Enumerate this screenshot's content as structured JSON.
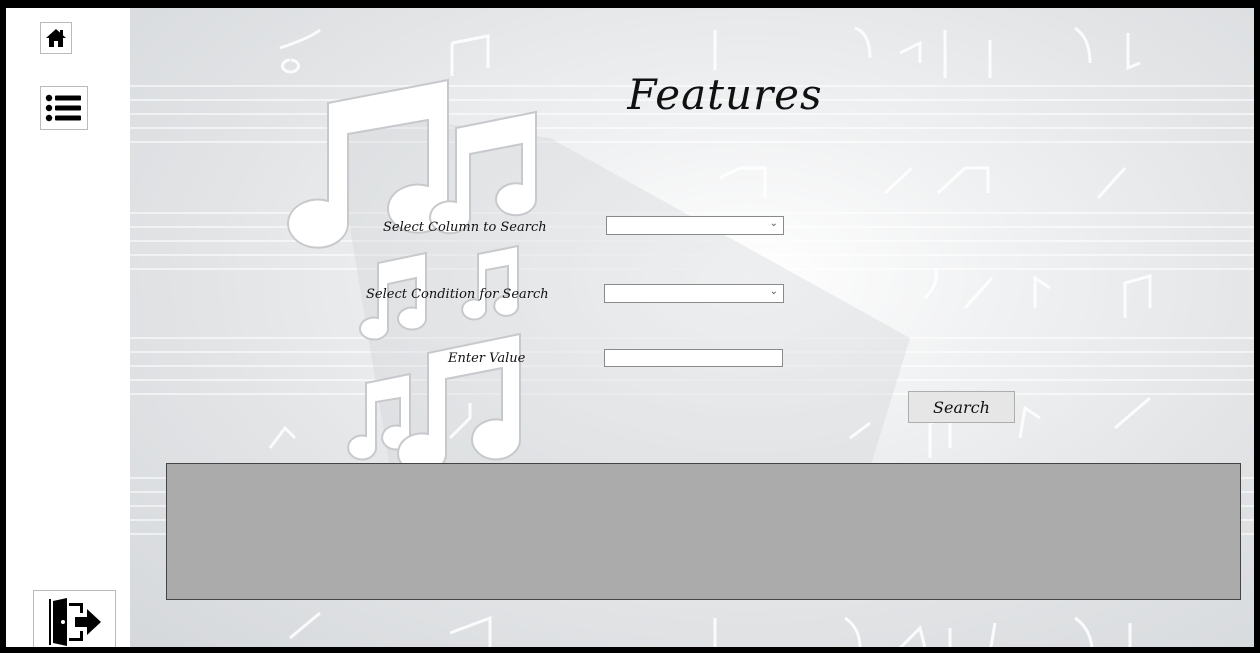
{
  "sidebar": {
    "home_icon": "home-icon",
    "menu_icon": "list-icon",
    "exit_icon": "exit-door-icon"
  },
  "main": {
    "title": "Features",
    "column_label": "Select Column to Search",
    "column_value": "",
    "condition_label": "Select Condition for Search",
    "condition_value": "",
    "value_label": "Enter Value",
    "value_input": "",
    "search_label": "Search"
  },
  "colors": {
    "results_panel": "#ababab",
    "frame": "#000000"
  }
}
